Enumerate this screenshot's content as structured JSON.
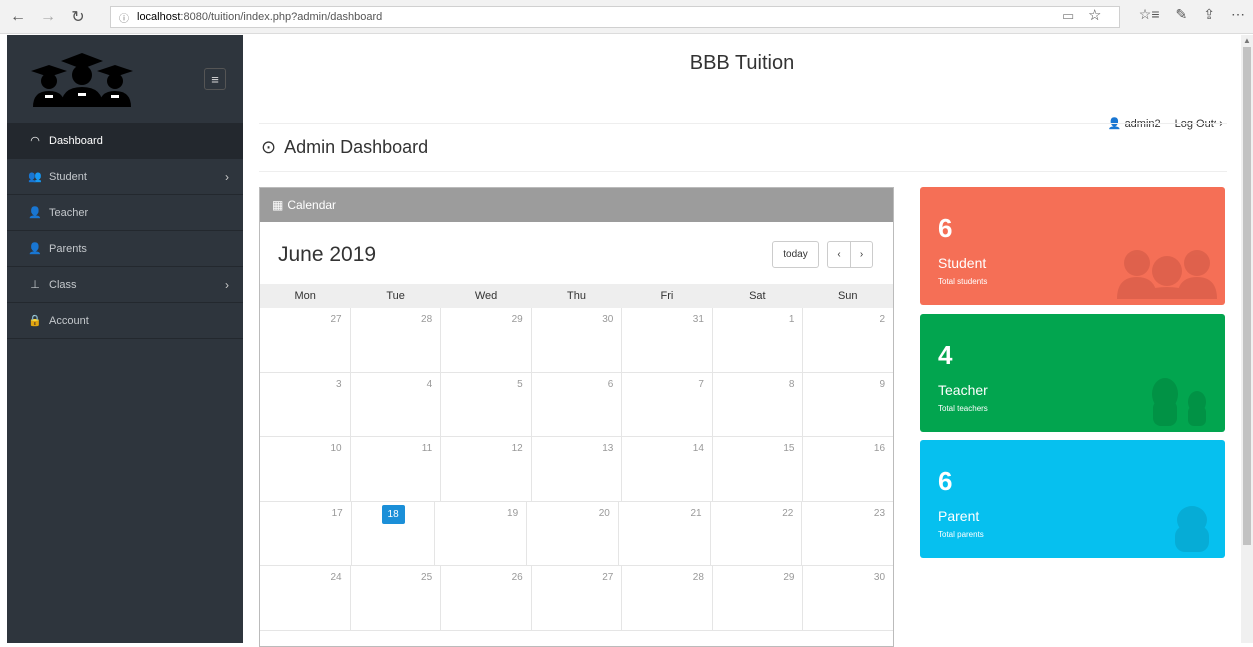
{
  "browser": {
    "url_host": "localhost",
    "url_path": ":8080/tuition/index.php?admin/dashboard"
  },
  "sidebar": {
    "items": [
      {
        "label": "Dashboard",
        "icon": "tachometer-icon"
      },
      {
        "label": "Student",
        "icon": "users-icon"
      },
      {
        "label": "Teacher",
        "icon": "teacher-icon"
      },
      {
        "label": "Parents",
        "icon": "user-icon"
      },
      {
        "label": "Class",
        "icon": "sitemap-icon"
      },
      {
        "label": "Account",
        "icon": "lock-icon"
      }
    ]
  },
  "header": {
    "title": "BBB Tuition",
    "username": "admin2",
    "logout": "Log Out"
  },
  "page": {
    "title": "Admin Dashboard"
  },
  "calendar": {
    "panel_title": "Calendar",
    "month_title": "June 2019",
    "today_label": "today",
    "prev_label": "‹",
    "next_label": "›",
    "weekdays": [
      "Mon",
      "Tue",
      "Wed",
      "Thu",
      "Fri",
      "Sat",
      "Sun"
    ],
    "weeks": [
      [
        "27",
        "28",
        "29",
        "30",
        "31",
        "1",
        "2"
      ],
      [
        "3",
        "4",
        "5",
        "6",
        "7",
        "8",
        "9"
      ],
      [
        "10",
        "11",
        "12",
        "13",
        "14",
        "15",
        "16"
      ],
      [
        "17",
        "18",
        "19",
        "20",
        "21",
        "22",
        "23"
      ],
      [
        "24",
        "25",
        "26",
        "27",
        "28",
        "29",
        "30"
      ]
    ],
    "today": "18"
  },
  "stats": {
    "student": {
      "count": "6",
      "label": "Student",
      "sub": "Total students",
      "color": "#f56f56"
    },
    "teacher": {
      "count": "4",
      "label": "Teacher",
      "sub": "Total teachers",
      "color": "#02a54f"
    },
    "parent": {
      "count": "6",
      "label": "Parent",
      "sub": "Total parents",
      "color": "#06c0ef"
    }
  }
}
